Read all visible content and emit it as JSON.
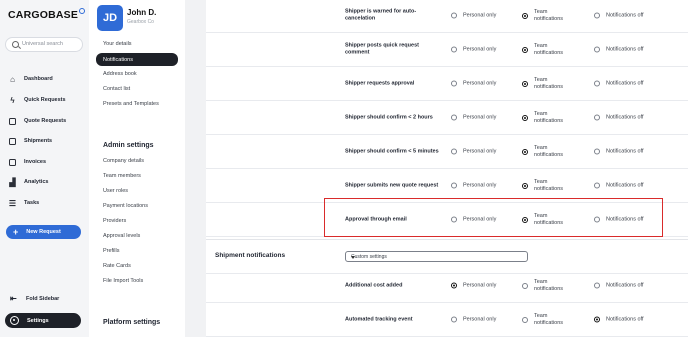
{
  "app": {
    "logo": "CARGOBASE"
  },
  "nav": {
    "search_placeholder": "Universal search",
    "items": [
      {
        "label": "Dashboard",
        "icon": "home-icon"
      },
      {
        "label": "Quick Requests",
        "icon": "bolt-icon"
      },
      {
        "label": "Quote Requests",
        "icon": "document-icon"
      },
      {
        "label": "Shipments",
        "icon": "box-icon"
      },
      {
        "label": "Invoices",
        "icon": "invoice-icon"
      },
      {
        "label": "Analytics",
        "icon": "chart-icon"
      },
      {
        "label": "Tasks",
        "icon": "list-icon"
      }
    ],
    "new_request": "New Request",
    "fold": "Fold Sidebar",
    "settings": "Settings"
  },
  "profile": {
    "initials": "JD",
    "name": "John D.",
    "company": "Gearbox Co"
  },
  "settings_menu": {
    "items": [
      "Your details",
      "Notifications",
      "Address book",
      "Contact list",
      "Presets and Templates"
    ],
    "active": "Notifications",
    "admin_heading": "Admin settings",
    "admin_items": [
      "Company details",
      "Team members",
      "User roles",
      "Payment locations",
      "Providers",
      "Approval levels",
      "Prefills",
      "Rate Cards",
      "File Import Tools"
    ],
    "platform_heading": "Platform settings"
  },
  "options": {
    "personal": "Personal only",
    "team": "Team notifications",
    "off": "Notifications off"
  },
  "rows": [
    {
      "label": "Shipper is warned for auto-cancelation",
      "selected": "team"
    },
    {
      "label": "Shipper posts quick request comment",
      "selected": "team"
    },
    {
      "label": "Shipper requests approval",
      "selected": "team"
    },
    {
      "label": "Shipper should confirm < 2 hours",
      "selected": "team"
    },
    {
      "label": "Shipper should confirm < 5 minutes",
      "selected": "team"
    },
    {
      "label": "Shipper submits new quote request",
      "selected": "team"
    },
    {
      "label": "Approval through email",
      "selected": "team"
    }
  ],
  "shipment_section": {
    "title": "Shipment notifications",
    "dropdown_value": "Custom settings"
  },
  "shipment_rows": [
    {
      "label": "Additional cost added",
      "selected": "personal"
    },
    {
      "label": "Automated tracking event",
      "selected": "off"
    }
  ],
  "highlight_color": "#d92b2b",
  "accent_color": "#2f6bd6"
}
